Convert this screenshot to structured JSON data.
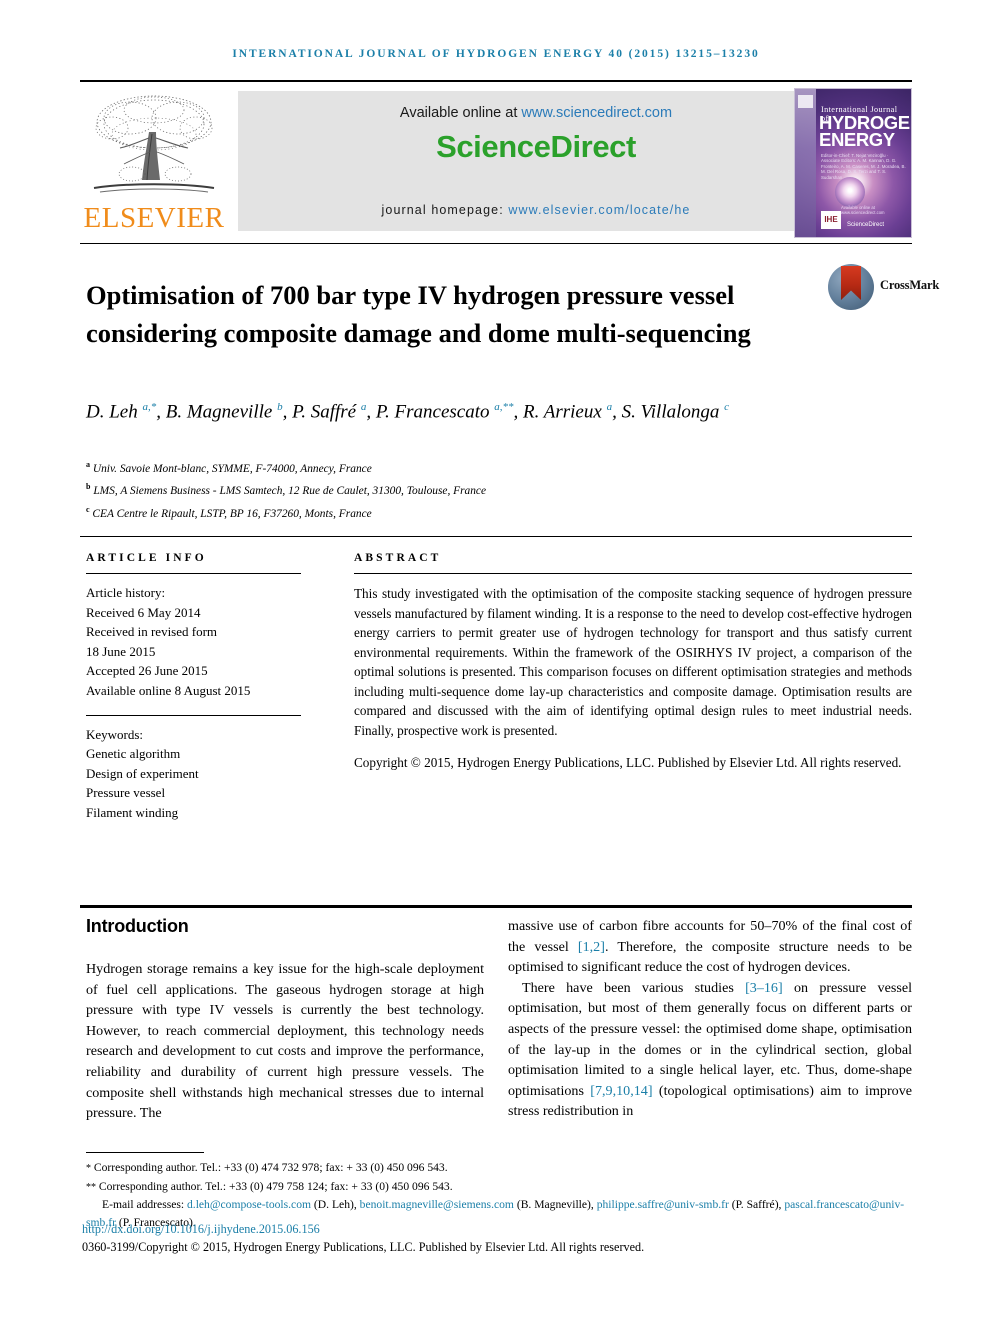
{
  "running_head": "International Journal of Hydrogen Energy 40 (2015) 13215–13230",
  "header": {
    "publisher_logo_word": "ELSEVIER",
    "available_online_prefix": "Available online at ",
    "available_online_url": "www.sciencedirect.com",
    "sciencedirect_logo": "ScienceDirect",
    "journal_homepage_prefix": "journal homepage: ",
    "journal_homepage_url": "www.elsevier.com/locate/he",
    "cover": {
      "title_small": "International Journal of",
      "title_big_line1": "HYDROGEN",
      "title_big_line2": "ENERGY",
      "editors": "Editor-in-Chief: T. Nejat Veziroğlu  ·  Associate Editors: A. M. Kannan, D. G. Fronteiro, A. M. Caseres, M. J. Moradea, B. M. Del Rosa, D. S. Terzi and T. S. Sudarshan",
      "footer_note": "Available online at www.sciencedirect.com",
      "badge": "IHE",
      "sciencedirect_mini": "ScienceDirect"
    }
  },
  "article": {
    "title": "Optimisation of 700 bar type IV hydrogen pressure vessel considering composite damage and dome multi-sequencing",
    "crossmark_label": "CrossMark",
    "authors_html": "D. Leh <sup>a,*</sup>, B. Magneville <sup>b</sup>, P. Saffré <sup>a</sup>, P. Francescato <sup>a,**</sup>, R. Arrieux <sup>a</sup>, S. Villalonga <sup>c</sup>",
    "affiliations": [
      "Univ. Savoie Mont-blanc, SYMME, F-74000, Annecy, France",
      "LMS, A Siemens Business - LMS Samtech, 12 Rue de Caulet, 31300, Toulouse, France",
      "CEA Centre le Ripault, LSTP, BP 16, F37260, Monts, France"
    ],
    "affiliation_markers": [
      "a",
      "b",
      "c"
    ]
  },
  "article_info": {
    "heading": "Article info",
    "history_heading": "Article history:",
    "history": [
      "Received 6 May 2014",
      "Received in revised form",
      "18 June 2015",
      "Accepted 26 June 2015",
      "Available online 8 August 2015"
    ],
    "keywords_heading": "Keywords:",
    "keywords": [
      "Genetic algorithm",
      "Design of experiment",
      "Pressure vessel",
      "Filament winding"
    ]
  },
  "abstract": {
    "heading": "Abstract",
    "body": "This study investigated with the optimisation of the composite stacking sequence of hydrogen pressure vessels manufactured by filament winding. It is a response to the need to develop cost-effective hydrogen energy carriers to permit greater use of hydrogen technology for transport and thus satisfy current environmental requirements. Within the framework of the OSIRHYS IV project, a comparison of the optimal solutions is presented. This comparison focuses on different optimisation strategies and methods including multi-sequence dome lay-up characteristics and composite damage. Optimisation results are compared and discussed with the aim of identifying optimal design rules to meet industrial needs. Finally, prospective work is presented.",
    "copyright": "Copyright © 2015, Hydrogen Energy Publications, LLC. Published by Elsevier Ltd. All rights reserved."
  },
  "body": {
    "section_heading": "Introduction",
    "left_paragraph": "Hydrogen storage remains a key issue for the high-scale deployment of fuel cell applications. The gaseous hydrogen storage at high pressure with type IV vessels is currently the best technology. However, to reach commercial deployment, this technology needs research and development to cut costs and improve the performance, reliability and durability of current high pressure vessels. The composite shell withstands high mechanical stresses due to internal pressure. The",
    "right_paragraph_1_a": "massive use of carbon fibre accounts for 50–70% of the final cost of the vessel ",
    "right_paragraph_1_cite": "[1,2]",
    "right_paragraph_1_b": ". Therefore, the composite structure needs to be optimised to significant reduce the cost of hydrogen devices.",
    "right_paragraph_2_a": "There have been various studies ",
    "right_paragraph_2_cite1": "[3–16]",
    "right_paragraph_2_b": " on pressure vessel optimisation, but most of them generally focus on different parts or aspects of the pressure vessel: the optimised dome shape, optimisation of the lay-up in the domes or in the cylindrical section, global optimisation limited to a single helical layer, etc. Thus, dome-shape optimisations ",
    "right_paragraph_2_cite2": "[7,9,10,14]",
    "right_paragraph_2_c": " (topological optimisations) aim to improve stress redistribution in"
  },
  "footnotes": {
    "corresponding_1": "Corresponding author. Tel.: +33 (0) 474 732 978; fax: + 33 (0) 450 096 543.",
    "corresponding_2": "Corresponding author. Tel.: +33 (0) 479 758 124; fax: + 33 (0) 450 096 543.",
    "email_label": "E-mail addresses: ",
    "emails": [
      {
        "address": "d.leh@compose-tools.com",
        "person": " (D. Leh), "
      },
      {
        "address": "benoit.magneville@siemens.com",
        "person": " (B. Magneville), "
      },
      {
        "address": "philippe.saffre@univ-smb.fr",
        "person": " (P. Saffré), "
      },
      {
        "address": "pascal.francescato@univ-smb.fr",
        "person": " (P. Francescato)."
      }
    ],
    "doi": "http://dx.doi.org/10.1016/j.ijhydene.2015.06.156",
    "issn_copyright": "0360-3199/Copyright © 2015, Hydrogen Energy Publications, LLC. Published by Elsevier Ltd. All rights reserved."
  },
  "colors": {
    "accent_blue": "#1b7fa8",
    "link_blue": "#2b7bb9",
    "sciencedirect_green": "#2ba12b",
    "elsevier_orange": "#f08c1b",
    "banner_grey": "#e3e3e3"
  }
}
